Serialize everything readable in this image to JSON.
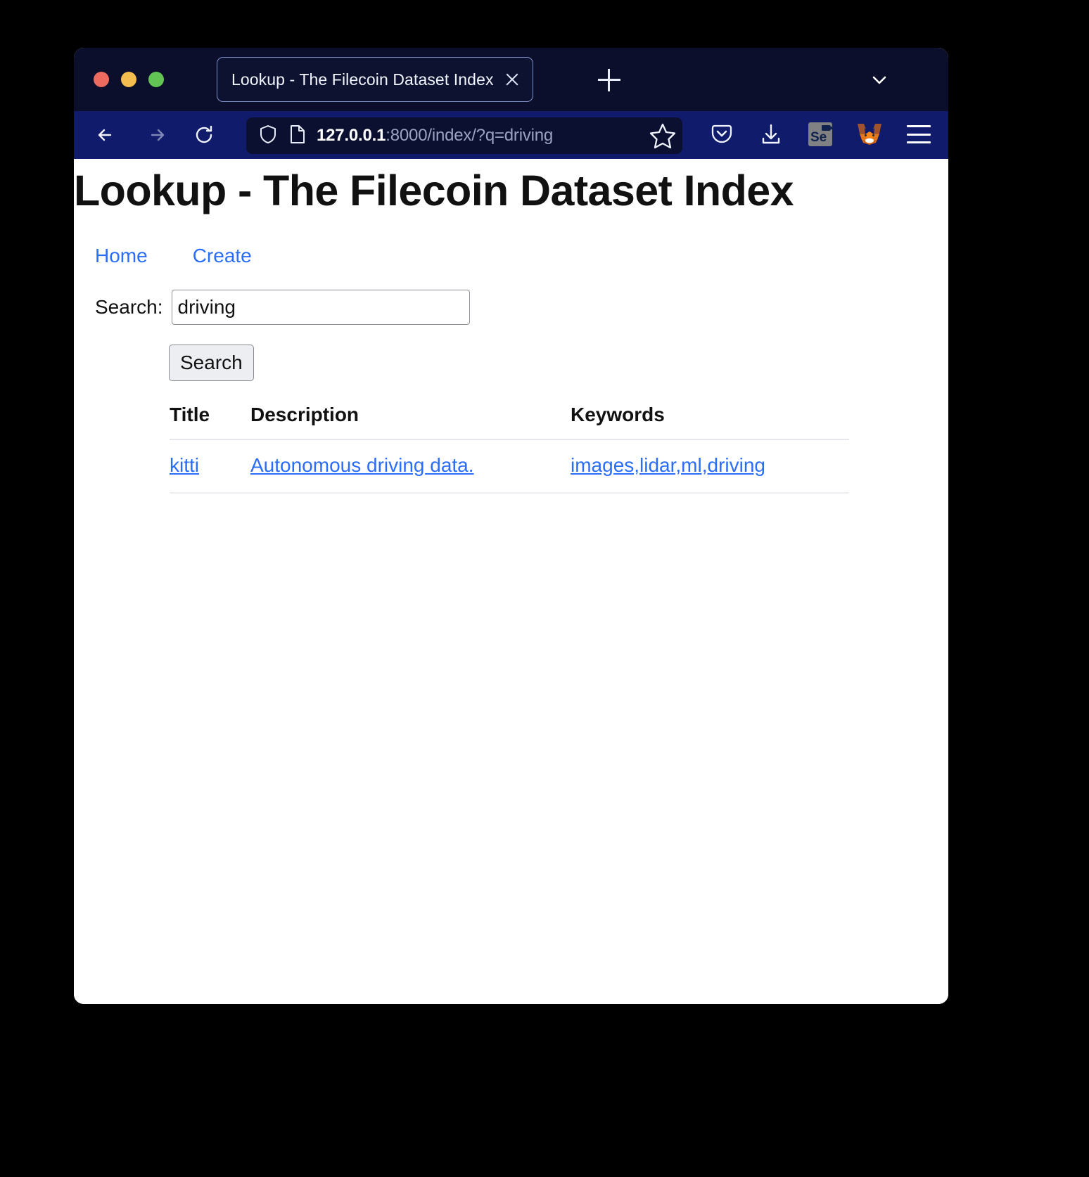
{
  "window": {
    "traffic_lights": [
      {
        "name": "close",
        "color": "#ed6a5e"
      },
      {
        "name": "minimize",
        "color": "#f5bd4f"
      },
      {
        "name": "zoom",
        "color": "#61c455"
      }
    ]
  },
  "browser": {
    "tab": {
      "title": "Lookup - The Filecoin Dataset Index",
      "close_icon": "close-icon"
    },
    "new_tab_icon": "plus-icon",
    "tab_list_icon": "chevron-down-icon",
    "toolbar": {
      "back_icon": "back-arrow-icon",
      "forward_icon": "forward-arrow-icon",
      "reload_icon": "reload-icon",
      "shield_icon": "shield-icon",
      "page_icon": "page-document-icon",
      "bookmark_icon": "star-icon",
      "pocket_icon": "pocket-icon",
      "downloads_icon": "download-icon",
      "selenium_icon": "selenium-ide-icon",
      "selenium_label": "Se",
      "metamask_icon": "metamask-fox-icon",
      "menu_icon": "hamburger-menu-icon"
    },
    "url": {
      "host": "127.0.0.1",
      "path": ":8000/index/?q=driving",
      "full": "127.0.0.1:8000/index/?q=driving"
    }
  },
  "page": {
    "title": "Lookup - The Filecoin Dataset Index",
    "nav": [
      {
        "label": "Home"
      },
      {
        "label": "Create"
      }
    ],
    "search": {
      "label": "Search:",
      "value": "driving",
      "placeholder": "",
      "button_label": "Search"
    },
    "table": {
      "headers": [
        "Title",
        "Description",
        "Keywords"
      ],
      "rows": [
        {
          "title": "kitti",
          "description": "Autonomous driving data.",
          "keywords": "images,lidar,ml,driving"
        }
      ]
    }
  }
}
